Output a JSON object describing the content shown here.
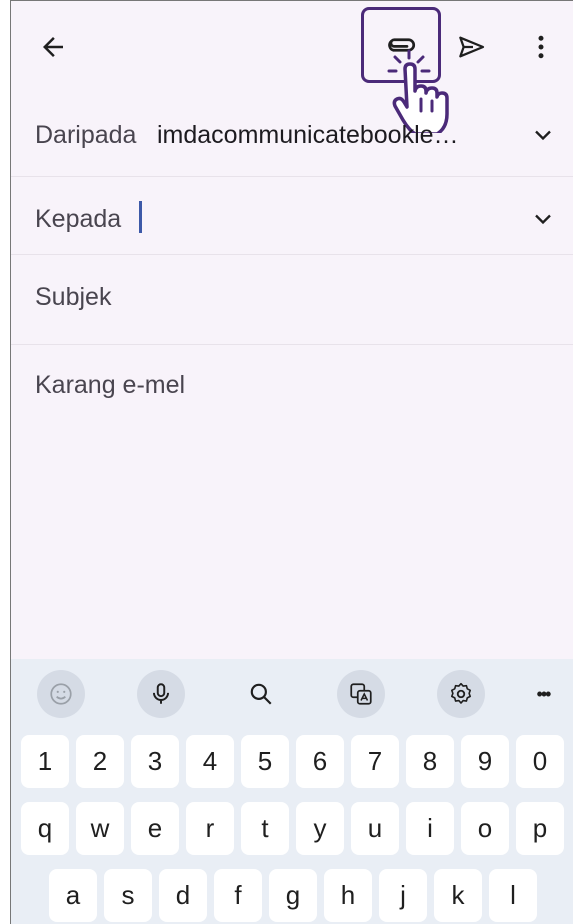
{
  "header": {
    "back_icon": "arrow-left-icon",
    "attach_icon": "paperclip-icon",
    "send_icon": "send-icon",
    "more_icon": "more-vert-icon"
  },
  "form": {
    "from_label": "Daripada",
    "from_value": "imdacommunicatebookle…",
    "to_label": "Kepada",
    "to_value": "",
    "subject_placeholder": "Subjek",
    "body_placeholder": "Karang e-mel"
  },
  "keyboard": {
    "toolbar": [
      "emoji-icon",
      "microphone-icon",
      "search-icon",
      "translate-icon",
      "settings-icon",
      "more-horiz-icon"
    ],
    "more_label": "•••",
    "numbers": [
      "1",
      "2",
      "3",
      "4",
      "5",
      "6",
      "7",
      "8",
      "9",
      "0"
    ],
    "row1": [
      "q",
      "w",
      "e",
      "r",
      "t",
      "y",
      "u",
      "i",
      "o",
      "p"
    ],
    "row2": [
      "a",
      "s",
      "d",
      "f",
      "g",
      "h",
      "j",
      "k",
      "l"
    ]
  },
  "colors": {
    "background": "#f8f3fa",
    "highlight": "#4b2a79",
    "cursor": "#3d59a8",
    "keyboard_bg": "#e9eef5"
  }
}
